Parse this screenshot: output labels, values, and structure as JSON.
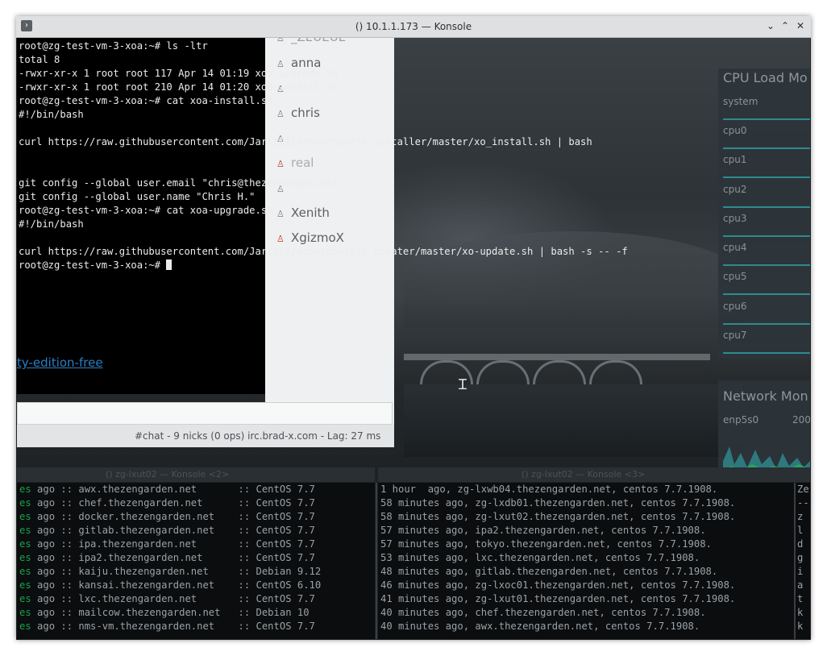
{
  "window": {
    "title": "() 10.1.1.173 — Konsole",
    "menu_glyph": "›",
    "min_glyph": "⌄",
    "max_glyph": "⌃",
    "close_glyph": "✕"
  },
  "terminal": {
    "lines": [
      "root@zg-test-vm-3-xoa:~# ls -ltr",
      "total 8",
      "-rwxr-xr-x 1 root root 117 Apr 14 01:19 xoa-upgrade.sh",
      "-rwxr-xr-x 1 root root 210 Apr 14 01:20 xoa-install.sh",
      "root@zg-test-vm-3-xoa:~# cat xoa-install.sh",
      "#!/bin/bash",
      "",
      "curl https://raw.githubusercontent.com/Jarli01/xenorchestra_installer/master/xo_install.sh | bash",
      "",
      "",
      "git config --global user.email \"chris@thezengarden.net\"",
      "git config --global user.name \"Chris H.\"",
      "root@zg-test-vm-3-xoa:~# cat xoa-upgrade.sh",
      "#!/bin/bash",
      "",
      "curl https://raw.githubusercontent.com/Jarli01/xenorchestra_updater/master/xo-update.sh | bash -s -- -f"
    ],
    "prompt": "root@zg-test-vm-3-xoa:~# "
  },
  "chat": {
    "nicks": [
      "_ZEUEUE",
      "anna",
      "",
      "chris",
      "",
      "real",
      "",
      "Xenith",
      "XgizmoX"
    ],
    "link_fragment": "ty-edition-free",
    "status": "#chat - 9 nicks (0 ops)  irc.brad-x.com - Lag: 27 ms"
  },
  "cpu_monitor": {
    "title": "CPU Load Mo",
    "labels": [
      "system",
      "cpu0",
      "cpu1",
      "cpu2",
      "cpu3",
      "cpu4",
      "cpu5",
      "cpu6",
      "cpu7"
    ],
    "accent": "#2e8b8f"
  },
  "network_monitor": {
    "title": "Network Mon",
    "iface": "enp5s0",
    "value": "200"
  },
  "bottom_left": {
    "title": "() zg-lxut02 — Konsole <2>",
    "rows": [
      [
        "es",
        " ago :: awx.thezengarden.net       :: CentOS 7.7"
      ],
      [
        "es",
        " ago :: chef.thezengarden.net      :: CentOS 7.7"
      ],
      [
        "es",
        " ago :: docker.thezengarden.net    :: CentOS 7.7"
      ],
      [
        "es",
        " ago :: gitlab.thezengarden.net    :: CentOS 7.7"
      ],
      [
        "es",
        " ago :: ipa.thezengarden.net       :: CentOS 7.7"
      ],
      [
        "es",
        " ago :: ipa2.thezengarden.net      :: CentOS 7.7"
      ],
      [
        "es",
        " ago :: kaiju.thezengarden.net     :: Debian 9.12"
      ],
      [
        "es",
        " ago :: kansai.thezengarden.net    :: CentOS 6.10"
      ],
      [
        "es",
        " ago :: lxc.thezengarden.net       :: CentOS 7.7"
      ],
      [
        "es",
        " ago :: mailcow.thezengarden.net   :: Debian 10"
      ],
      [
        "es",
        " ago :: nms-vm.thezengarden.net    :: CentOS 7.7"
      ]
    ]
  },
  "bottom_right": {
    "title": "() zg-lxut02 — Konsole <3>",
    "rows": [
      "1 hour  ago, zg-lxwb04.thezengarden.net, centos 7.7.1908.",
      "58 minutes ago, zg-lxdb01.thezengarden.net, centos 7.7.1908.",
      "58 minutes ago, zg-lxut02.thezengarden.net, centos 7.7.1908.",
      "57 minutes ago, ipa2.thezengarden.net, centos 7.7.1908.",
      "57 minutes ago, tokyo.thezengarden.net, centos 7.7.1908.",
      "53 minutes ago, lxc.thezengarden.net, centos 7.7.1908.",
      "48 minutes ago, gitlab.thezengarden.net, centos 7.7.1908.",
      "46 minutes ago, zg-lxoc01.thezengarden.net, centos 7.7.1908.",
      "41 minutes ago, zg-lxut01.thezengarden.net, centos 7.7.1908.",
      "40 minutes ago, chef.thezengarden.net, centos 7.7.1908.",
      "40 minutes ago, awx.thezengarden.net, centos 7.7.1908."
    ],
    "edge": [
      "Ze",
      "--",
      "z",
      "l",
      "d",
      "g",
      "i",
      "a",
      "t",
      "k",
      "k"
    ]
  }
}
